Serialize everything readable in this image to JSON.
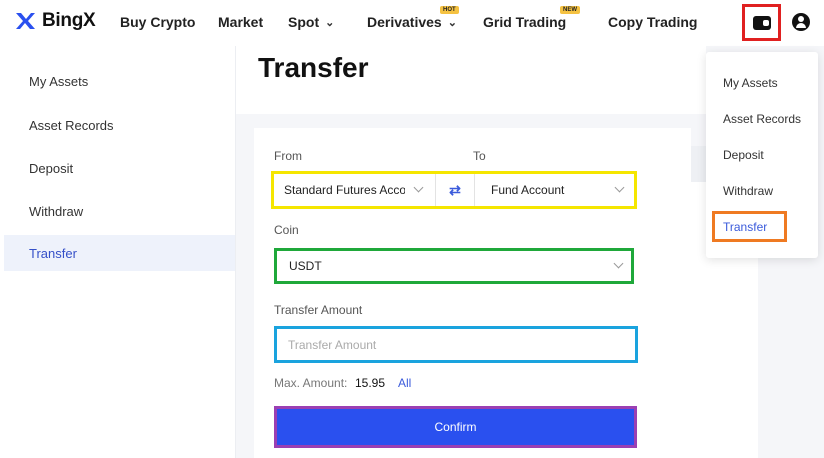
{
  "brand": {
    "name": "BingX",
    "accent": "#2a50ef"
  },
  "nav": {
    "items": [
      {
        "label": "Buy Crypto"
      },
      {
        "label": "Market"
      },
      {
        "label": "Spot"
      },
      {
        "label": "Derivatives",
        "badge": "HOT"
      },
      {
        "label": "Grid Trading",
        "badge": "NEW"
      },
      {
        "label": "Copy Trading"
      }
    ]
  },
  "sidebar": {
    "items": [
      {
        "label": "My Assets"
      },
      {
        "label": "Asset Records"
      },
      {
        "label": "Deposit"
      },
      {
        "label": "Withdraw"
      },
      {
        "label": "Transfer",
        "active": true
      }
    ]
  },
  "page": {
    "title": "Transfer"
  },
  "form": {
    "from_label": "From",
    "to_label": "To",
    "from_value": "Standard Futures Account",
    "to_value": "Fund Account",
    "coin_label": "Coin",
    "coin_value": "USDT",
    "amount_label": "Transfer Amount",
    "amount_placeholder": "Transfer Amount",
    "max_label": "Max. Amount:",
    "max_value": "15.95",
    "all_label": "All",
    "confirm_label": "Confirm"
  },
  "dropdown": {
    "items": [
      {
        "label": "My Assets"
      },
      {
        "label": "Asset Records"
      },
      {
        "label": "Deposit"
      },
      {
        "label": "Withdraw"
      },
      {
        "label": "Transfer",
        "active": true
      }
    ]
  },
  "highlight_colors": {
    "wallet": "#e02020",
    "account_select": "#f5e600",
    "coin_select": "#1fa83a",
    "amount_input": "#1aa3de",
    "confirm_button": "#9b3fb3",
    "dropdown_transfer": "#ef7a22"
  }
}
